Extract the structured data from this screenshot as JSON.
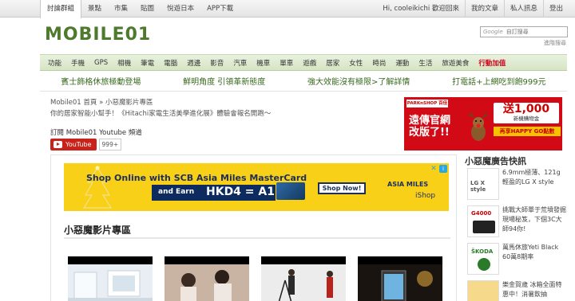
{
  "top_nav": {
    "tabs": [
      "討論群組",
      "景點",
      "市集",
      "貼圖",
      "悅遊日本",
      "APP下載"
    ],
    "active": 0
  },
  "user_bar": {
    "greeting": "Hi, cooleikichi 歡迎回來",
    "items": [
      "我的文章",
      "私人訊息",
      "登出"
    ]
  },
  "logo": {
    "text": "MOBILE01"
  },
  "search": {
    "brand": "Google",
    "placeholder": "自訂搜尋",
    "advanced_label": "進階搜尋"
  },
  "category_nav": {
    "items": [
      "功能",
      "手機",
      "GPS",
      "相機",
      "筆電",
      "電腦",
      "週邊",
      "影音",
      "汽車",
      "機車",
      "單車",
      "遊戲",
      "居家",
      "女性",
      "時尚",
      "運動",
      "生活",
      "旅遊美食"
    ],
    "highlight": "行動加值"
  },
  "promo_strip": {
    "items": [
      "賓士飾格休旅極動登場",
      "鮮明角度 引領革新態度",
      "強大效能沒有極限>了解詳情",
      "打電話+上網吃到飽999元"
    ]
  },
  "breadcrumb": {
    "home": "Mobile01 首頁",
    "separator": "»",
    "current": "小惡魔影片專區"
  },
  "subtitle": "你的居家智能小幫手！《Hitachi家電生活美學進化展》體驗會報名開跑～",
  "subscribe": {
    "label": "訂閱 Mobile01 Youtube 頻道",
    "button": "YouTube",
    "count": "999+"
  },
  "right_ad": {
    "store": "PARKnSHOP 百佳",
    "headline_1": "遠傳官網",
    "headline_2": "改版了!!",
    "coupon_label": "送",
    "coupon_amount": "1,000",
    "coupon_sub": "新機購物金",
    "happy_go": "再享HAPPY GO點數"
  },
  "banner_ad": {
    "line1": "Shop Online with SCB Asia Miles MasterCard",
    "earn": "and Earn",
    "hkd": "HKD4 = A1",
    "cta": "Shop Now!",
    "partner": "ASIA MILES",
    "partner_sub": "iShop"
  },
  "section": {
    "title": "小惡魔影片專區"
  },
  "right_column": {
    "title": "小惡魔廣告快訊",
    "items": [
      {
        "brand": "LG X style",
        "text": "6.9mm極薄、121g輕盈的LG X style"
      },
      {
        "brand": "G4000",
        "text": "挑戰大師單于荒墳發掘現場秘笈，下個3C大師94你!"
      },
      {
        "brand": "ŠKODA",
        "text": "萬馬休旅Yeti Black 60萬8期率"
      },
      {
        "brand": "",
        "text": "樂金賀歲 冰箱全面特惠中！消暑飲抽"
      }
    ]
  },
  "colors": {
    "logo_green": "#4d7a2c",
    "nav_green": "#d6e5c3",
    "promo_green": "#3a6a1f",
    "youtube_red": "#c9221a",
    "ad_red": "#d20a15",
    "banner_yellow": "#f9d018"
  }
}
